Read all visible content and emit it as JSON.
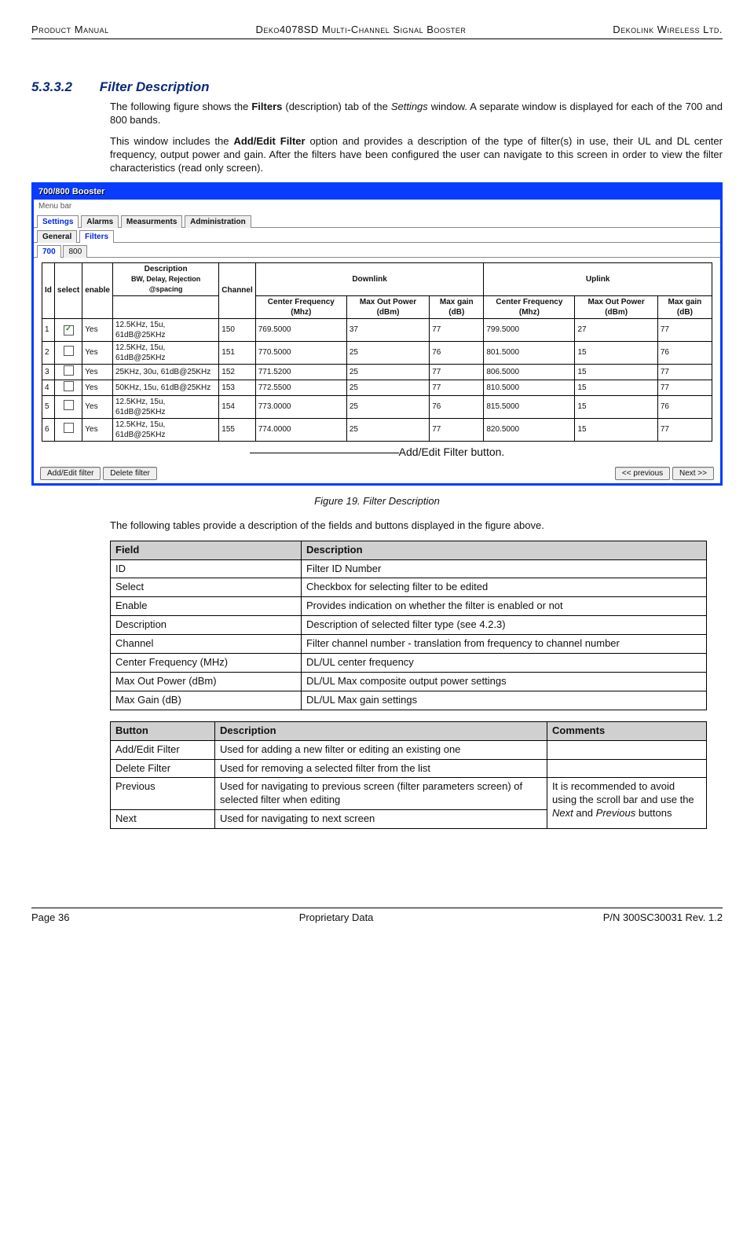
{
  "running_head": {
    "left": "Product Manual",
    "center": "Deko4078SD Multi-Channel Signal Booster",
    "right": "Dekolink Wireless Ltd."
  },
  "heading": {
    "number": "5.3.3.2",
    "title": "Filter Description"
  },
  "para1_a": "The following figure shows the ",
  "para1_b": "Filters",
  "para1_c": " (description) tab of the ",
  "para1_d": "Settings",
  "para1_e": " window. A separate window is displayed for each of the 700 and 800 bands.",
  "para2_a": "This window includes the ",
  "para2_b": "Add/Edit Filter",
  "para2_c": " option and provides a description of the type of filter(s) in use, their UL and DL center frequency, output power and gain. After the filters have been configured the user can navigate to this screen in order to view the filter characteristics (read only screen).",
  "screenshot": {
    "window_title": "700/800 Booster",
    "menu_bar": "Menu bar",
    "tabs_main": [
      "Settings",
      "Alarms",
      "Measurments",
      "Administration"
    ],
    "tabs_sub1": [
      "General",
      "Filters"
    ],
    "tabs_sub2": [
      "700",
      "800"
    ],
    "headers": {
      "id": "Id",
      "select": "select",
      "enable": "enable",
      "description": "Description",
      "description_sub": "BW,  Delay, Rejection @spacing",
      "channel": "Channel",
      "downlink": "Downlink",
      "uplink": "Uplink",
      "center": "Center Frequency (Mhz)",
      "maxout": "Max Out Power (dBm)",
      "maxgain": "Max gain (dB)"
    },
    "rows": [
      {
        "id": "1",
        "sel": true,
        "enable": "Yes",
        "desc": "12.5KHz, 15u, 61dB@25KHz",
        "ch": "150",
        "dcf": "769.5000",
        "dmo": "37",
        "dmg": "77",
        "ucf": "799.5000",
        "umo": "27",
        "umg": "77"
      },
      {
        "id": "2",
        "sel": false,
        "enable": "Yes",
        "desc": "12.5KHz, 15u, 61dB@25KHz",
        "ch": "151",
        "dcf": "770.5000",
        "dmo": "25",
        "dmg": "76",
        "ucf": "801.5000",
        "umo": "15",
        "umg": "76"
      },
      {
        "id": "3",
        "sel": false,
        "enable": "Yes",
        "desc": "25KHz,    30u, 61dB@25KHz",
        "ch": "152",
        "dcf": "771.5200",
        "dmo": "25",
        "dmg": "77",
        "ucf": "806.5000",
        "umo": "15",
        "umg": "77"
      },
      {
        "id": "4",
        "sel": false,
        "enable": "Yes",
        "desc": "50KHz,    15u, 61dB@25KHz",
        "ch": "153",
        "dcf": "772.5500",
        "dmo": "25",
        "dmg": "77",
        "ucf": "810.5000",
        "umo": "15",
        "umg": "77"
      },
      {
        "id": "5",
        "sel": false,
        "enable": "Yes",
        "desc": "12.5KHz, 15u, 61dB@25KHz",
        "ch": "154",
        "dcf": "773.0000",
        "dmo": "25",
        "dmg": "76",
        "ucf": "815.5000",
        "umo": "15",
        "umg": "76"
      },
      {
        "id": "6",
        "sel": false,
        "enable": "Yes",
        "desc": "12.5KHz, 15u, 61dB@25KHz",
        "ch": "155",
        "dcf": "774.0000",
        "dmo": "25",
        "dmg": "77",
        "ucf": "820.5000",
        "umo": "15",
        "umg": "77"
      }
    ],
    "callout": "Add/Edit Filter button.",
    "buttons": {
      "add_edit": "Add/Edit filter",
      "delete": "Delete filter",
      "prev": "<< previous",
      "next": "Next  >>"
    }
  },
  "figure_caption": "Figure 19. Filter Description",
  "tables_intro": "The following tables provide a description of the fields and buttons displayed in the figure above.",
  "fields_table": {
    "head": [
      "Field",
      "Description"
    ],
    "rows": [
      [
        "ID",
        "Filter ID Number"
      ],
      [
        "Select",
        "Checkbox for selecting filter to be edited"
      ],
      [
        "Enable",
        "Provides indication on whether the filter is enabled or not"
      ],
      [
        "Description",
        "Description of  selected  filter type  (see 4.2.3)"
      ],
      [
        "Channel",
        "Filter channel number  - translation from frequency to channel number"
      ],
      [
        "Center Frequency (MHz)",
        "DL/UL center frequency"
      ],
      [
        "Max Out Power (dBm)",
        "DL/UL Max composite output power settings"
      ],
      [
        "Max Gain (dB)",
        "DL/UL Max gain settings"
      ]
    ]
  },
  "buttons_table": {
    "head": [
      "Button",
      "Description",
      "Comments"
    ],
    "rows": [
      [
        "Add/Edit Filter",
        "Used for adding a new filter or editing an existing one",
        ""
      ],
      [
        "Delete Filter",
        "Used for removing a selected filter from the list",
        ""
      ],
      [
        "Previous",
        "Used for navigating to previous screen (filter parameters screen) of selected filter when editing",
        ""
      ],
      [
        "Next",
        "Used for navigating to next screen",
        ""
      ]
    ],
    "merged_comment_a": "It is recommended to avoid using the scroll bar and use the ",
    "merged_comment_b": "Next",
    "merged_comment_c": " and ",
    "merged_comment_d": "Previous",
    "merged_comment_e": " buttons"
  },
  "footer": {
    "left": "Page 36",
    "center": "Proprietary Data",
    "right": "P/N 300SC30031 Rev. 1.2"
  }
}
